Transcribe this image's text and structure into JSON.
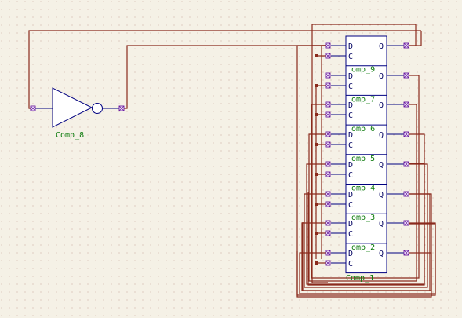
{
  "canvas": {
    "background": "#f5f1e6",
    "grid_color": "#c7aaa0"
  },
  "colors": {
    "wire": "#8a2a1c",
    "component": "#000080",
    "pin": "#6a1aa0",
    "label_green": "#0b7a0b"
  },
  "inverter": {
    "name": "Comp_8"
  },
  "register": {
    "name": "Comp_1",
    "cells": [
      {
        "d": "D",
        "c": "C",
        "q": "Q",
        "tag": ""
      },
      {
        "d": "D",
        "c": "C",
        "q": "Q",
        "tag": "omp_9"
      },
      {
        "d": "D",
        "c": "C",
        "q": "Q",
        "tag": "omp_7"
      },
      {
        "d": "D",
        "c": "C",
        "q": "Q",
        "tag": "omp_6"
      },
      {
        "d": "D",
        "c": "C",
        "q": "Q",
        "tag": "omp_5"
      },
      {
        "d": "D",
        "c": "C",
        "q": "Q",
        "tag": "omp_4"
      },
      {
        "d": "D",
        "c": "C",
        "q": "Q",
        "tag": "omp_3"
      },
      {
        "d": "D",
        "c": "C",
        "q": "Q",
        "tag": "omp_2"
      }
    ]
  }
}
